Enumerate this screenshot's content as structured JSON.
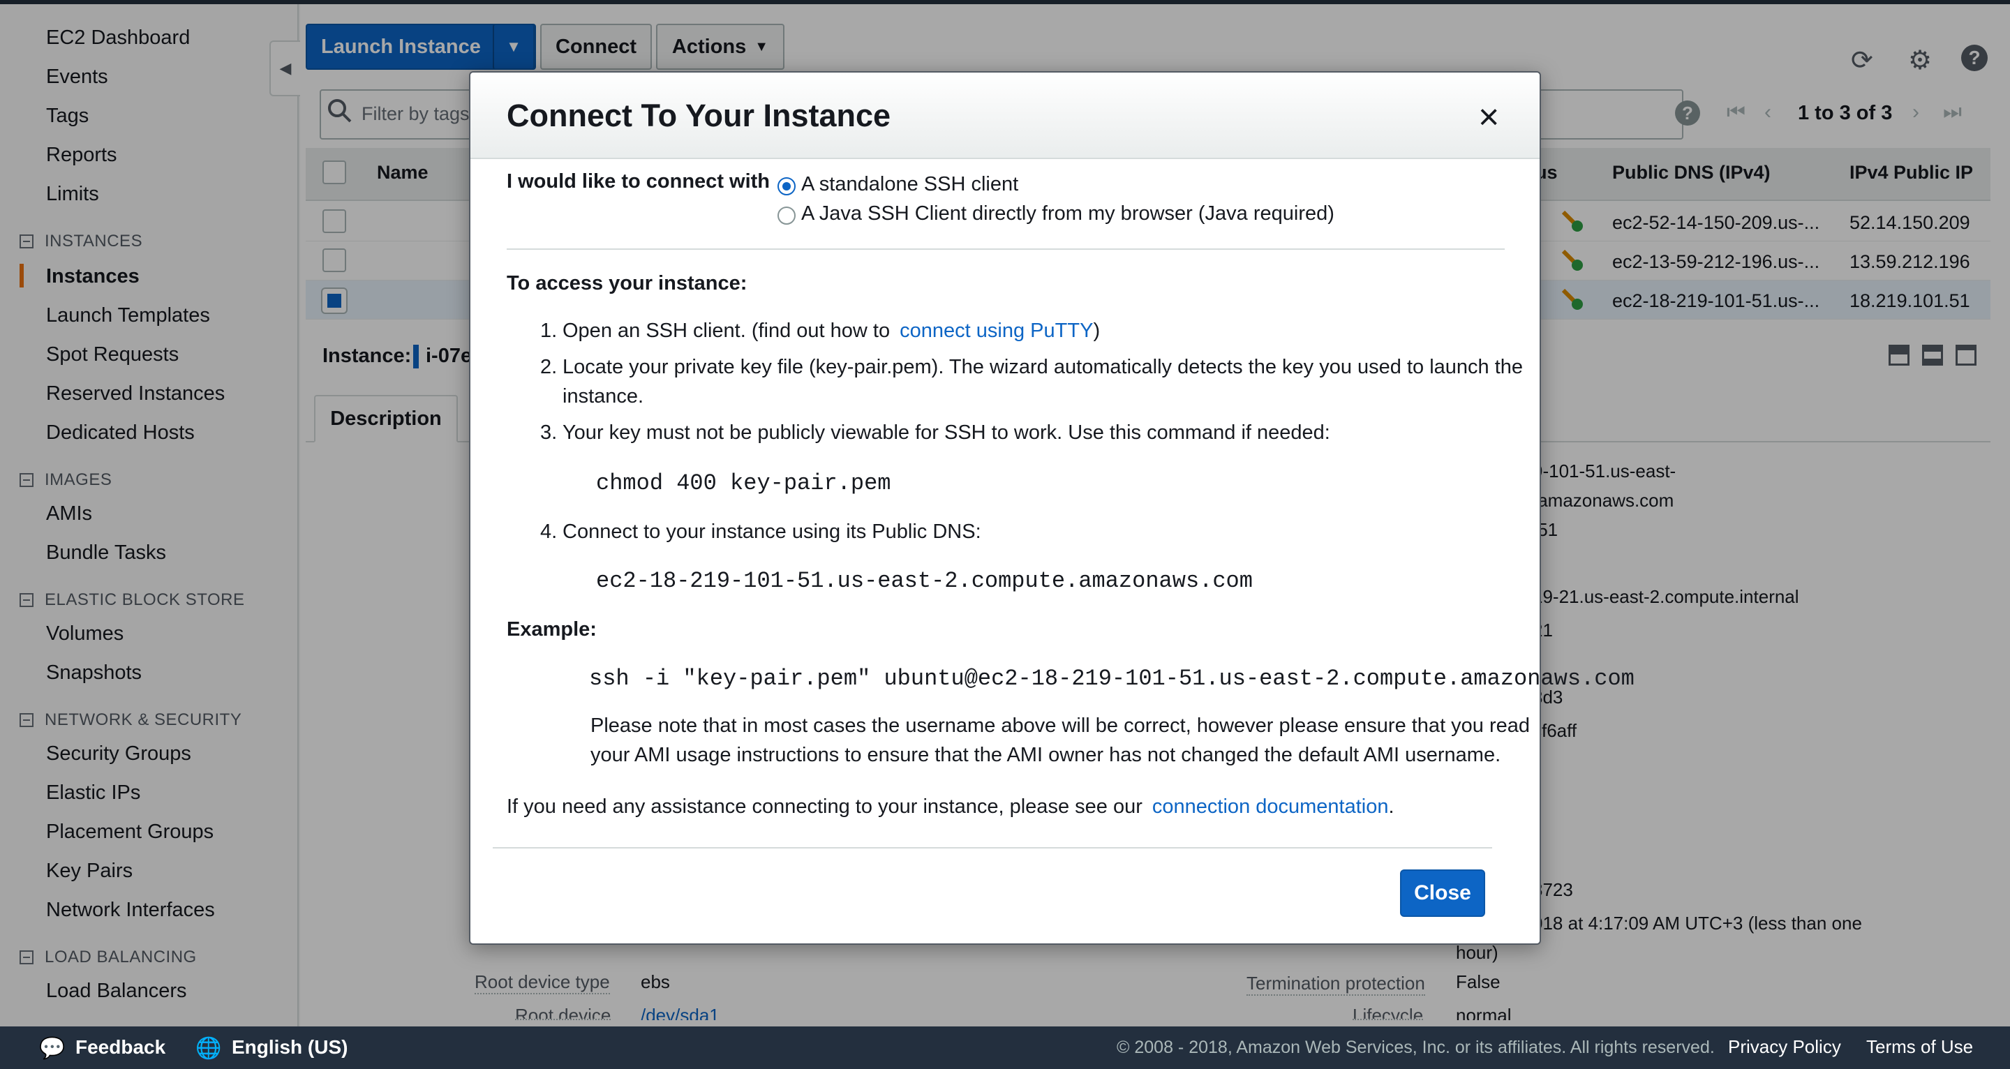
{
  "sidebar": {
    "items": [
      {
        "label": "EC2 Dashboard"
      },
      {
        "label": "Events"
      },
      {
        "label": "Tags"
      },
      {
        "label": "Reports"
      },
      {
        "label": "Limits"
      }
    ],
    "sections": [
      {
        "title": "INSTANCES",
        "items": [
          "Instances",
          "Launch Templates",
          "Spot Requests",
          "Reserved Instances",
          "Dedicated Hosts"
        ]
      },
      {
        "title": "IMAGES",
        "items": [
          "AMIs",
          "Bundle Tasks"
        ]
      },
      {
        "title": "ELASTIC BLOCK STORE",
        "items": [
          "Volumes",
          "Snapshots"
        ]
      },
      {
        "title": "NETWORK & SECURITY",
        "items": [
          "Security Groups",
          "Elastic IPs",
          "Placement Groups",
          "Key Pairs",
          "Network Interfaces"
        ]
      },
      {
        "title": "LOAD BALANCING",
        "items": [
          "Load Balancers"
        ]
      }
    ],
    "active": "Instances"
  },
  "toolbar": {
    "launch_label": "Launch Instance",
    "connect_label": "Connect",
    "actions_label": "Actions"
  },
  "filter": {
    "placeholder": "Filter by tags"
  },
  "pager": {
    "text": "1 to 3 of 3"
  },
  "table": {
    "headers": {
      "name": "Name",
      "status": "us",
      "public_dns": "Public DNS (IPv4)",
      "public_ip": "IPv4 Public IP"
    },
    "rows": [
      {
        "dns": "ec2-52-14-150-209.us-...",
        "ip": "52.14.150.209",
        "selected": false
      },
      {
        "dns": "ec2-13-59-212-196.us-...",
        "ip": "13.59.212.196",
        "selected": false
      },
      {
        "dns": "ec2-18-219-101-51.us-...",
        "ip": "18.219.101.51",
        "selected": true
      }
    ]
  },
  "details": {
    "instance_label": "Instance:",
    "instance_id": "i-07e",
    "tab_description": "Description",
    "fragments": [
      "9-101-51.us-east-",
      ".amazonaws.com",
      ".51",
      "19-21.us-east-2.compute.internal",
      "21",
      "3d3",
      "cf6aff",
      "8723",
      "018 at 4:17:09 AM UTC+3 (less than one",
      "hour)"
    ],
    "root_device_type_key": "Root device type",
    "root_device_type_val": "ebs",
    "termination_key": "Termination protection",
    "termination_val": "False",
    "root_device_key": "Root device",
    "root_device_val": "/dev/sda1",
    "lifecycle_key": "Lifecycle",
    "lifecycle_val": "normal"
  },
  "modal": {
    "title": "Connect To Your Instance",
    "connect_with_label": "I would like to connect with",
    "option_standalone": "A standalone SSH client",
    "option_java": "A Java SSH Client directly from my browser (Java required)",
    "access_heading": "To access your instance:",
    "step1_num": "1.",
    "step1_text": "Open an SSH client. (find out how to",
    "step1_link": "connect using PuTTY",
    "step1_end": ")",
    "step2_num": "2.",
    "step2_line1": "Locate your private key file (key-pair.pem). The wizard automatically detects the key you used to launch the",
    "step2_line2": "instance.",
    "step3_num": "3.",
    "step3_text": "Your key must not be publicly viewable for SSH to work. Use this command if needed:",
    "chmod_cmd": "chmod 400 key-pair.pem",
    "step4_num": "4.",
    "step4_text": "Connect to your instance using its Public DNS:",
    "public_dns": "ec2-18-219-101-51.us-east-2.compute.amazonaws.com",
    "example_heading": "Example:",
    "ssh_cmd": "ssh -i \"key-pair.pem\" ubuntu@ec2-18-219-101-51.us-east-2.compute.amazonaws.com",
    "note_line1": "Please note that in most cases the username above will be correct, however please ensure that you read",
    "note_line2": "your AMI usage instructions to ensure that the AMI owner has not changed the default AMI username.",
    "assist_text": "If you need any assistance connecting to your instance, please see our",
    "assist_link": "connection documentation",
    "assist_end": ".",
    "close_label": "Close"
  },
  "footer": {
    "feedback": "Feedback",
    "language": "English (US)",
    "copyright": "© 2008 - 2018, Amazon Web Services, Inc. or its affiliates. All rights reserved.",
    "privacy": "Privacy Policy",
    "terms": "Terms of Use"
  },
  "icons": {
    "refresh": "refresh-icon",
    "settings": "gear-icon",
    "help": "help-icon",
    "close": "close-icon"
  },
  "colors": {
    "primary": "#0d65c5",
    "active_accent": "#ec7211",
    "footer_bg": "#232f3e"
  }
}
